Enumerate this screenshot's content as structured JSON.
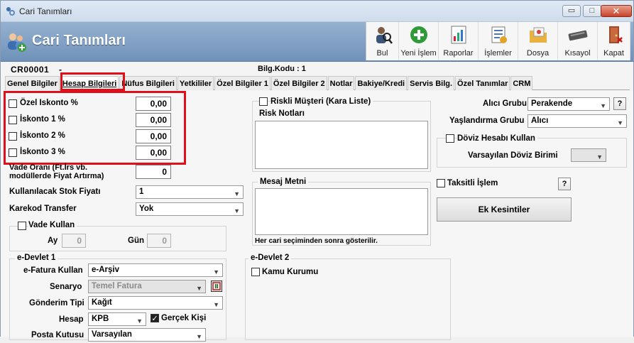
{
  "window": {
    "title": "Cari Tanımları",
    "minimize": "▭",
    "maximize": "□",
    "close": "✕"
  },
  "header": {
    "title": "Cari Tanımları"
  },
  "toolbar": [
    {
      "label": "Bul",
      "icon": "search-user-icon"
    },
    {
      "label": "Yeni İşlem",
      "icon": "add-plus-icon"
    },
    {
      "label": "Raporlar",
      "icon": "report-icon"
    },
    {
      "label": "İşlemler",
      "icon": "operations-icon"
    },
    {
      "label": "Dosya",
      "icon": "folder-icon"
    },
    {
      "label": "Kısayol",
      "icon": "keyboard-icon"
    },
    {
      "label": "Kapat",
      "icon": "exit-door-icon"
    }
  ],
  "info": {
    "code": "CR00001",
    "dash": "-",
    "bilg": "Bilg.Kodu : 1"
  },
  "tabs": [
    {
      "label": "Genel Bilgiler",
      "active": false
    },
    {
      "label": "Hesap Bilgileri",
      "active": true
    },
    {
      "label": "Nüfus Bilgileri",
      "active": false
    },
    {
      "label": "Yetkililer",
      "active": false
    },
    {
      "label": "Özel Bilgiler 1",
      "active": false
    },
    {
      "label": "Özel Bilgiler 2",
      "active": false
    },
    {
      "label": "Notlar",
      "active": false
    },
    {
      "label": "Bakiye/Kredi",
      "active": false
    },
    {
      "label": "Servis Bilg.",
      "active": false
    },
    {
      "label": "Özel Tanımlar",
      "active": false
    },
    {
      "label": "CRM",
      "active": false
    }
  ],
  "discounts": {
    "ozel_label": "Özel Iskonto %",
    "ozel_value": "0,00",
    "isk1_label": "İskonto 1 %",
    "isk1_value": "0,00",
    "isk2_label": "İskonto 2 %",
    "isk2_value": "0,00",
    "isk3_label": "İskonto 3 %",
    "isk3_value": "0,00"
  },
  "vade_orani": {
    "label": "Vade Oranı (Ft.İrs vb. modüllerde Fiyat Artırma)",
    "value": "0"
  },
  "stok_fiyati": {
    "label": "Kullanılacak Stok Fiyatı",
    "value": "1"
  },
  "karekod": {
    "label": "Karekod Transfer",
    "value": "Yok"
  },
  "vade_kullan": {
    "label": "Vade Kullan",
    "ay_label": "Ay",
    "ay_value": "0",
    "gun_label": "Gün",
    "gun_value": "0"
  },
  "risk": {
    "check_label": "Riskli Müşteri (Kara Liste)",
    "notes_label": "Risk Notları"
  },
  "mesaj": {
    "label": "Mesaj Metni",
    "hint": "Her cari seçiminden sonra gösterilir."
  },
  "right": {
    "alici_grubu_label": "Alıcı Grubu",
    "alici_grubu_value": "Perakende",
    "help": "?",
    "yaslandirma_label": "Yaşlandırma Grubu",
    "yaslandirma_value": "Alıcı",
    "doviz_label": "Döviz Hesabı Kullan",
    "varsayilan_doviz_label": "Varsayılan Döviz Birimi",
    "taksitli_label": "Taksitli İşlem",
    "ek_kesintiler": "Ek Kesintiler"
  },
  "edevlet1": {
    "title": "e-Devlet 1",
    "efatura_label": "e-Fatura Kullan",
    "efatura_value": "e-Arşiv",
    "senaryo_label": "Senaryo",
    "senaryo_value": "Temel Fatura",
    "gonderim_label": "Gönderim Tipi",
    "gonderim_value": "Kağıt",
    "hesap_label": "Hesap",
    "hesap_value": "KPB",
    "gercek_kisi_label": "Gerçek Kişi",
    "posta_label": "Posta Kutusu",
    "posta_value": "Varsayılan"
  },
  "edevlet2": {
    "title": "e-Devlet 2",
    "kamu_label": "Kamu Kurumu"
  },
  "colors": {
    "highlight": "#e0101a",
    "header": "#7f9fc4"
  }
}
